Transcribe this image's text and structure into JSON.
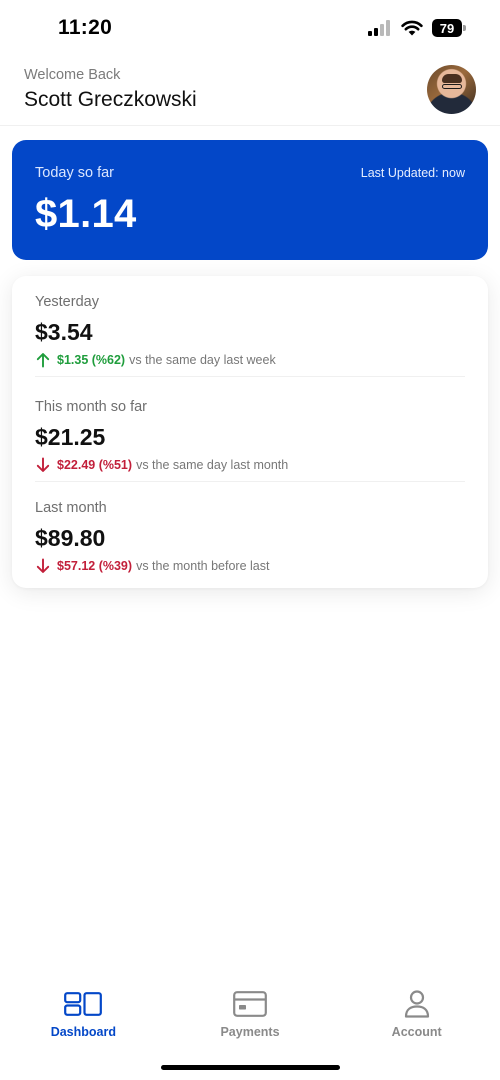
{
  "status_bar": {
    "time": "11:20",
    "battery": "79",
    "icons": [
      "cellular-signal-icon",
      "wifi-icon",
      "battery-icon"
    ]
  },
  "header": {
    "welcome": "Welcome Back",
    "user_name": "Scott Greczkowski"
  },
  "today": {
    "label": "Today so far",
    "last_updated": "Last Updated: now",
    "amount": "$1.14",
    "background_color": "#0347c8"
  },
  "stats": [
    {
      "title": "Yesterday",
      "amount": "$3.54",
      "direction": "up",
      "change": "$1.35 (%62)",
      "suffix": "vs the same day last week"
    },
    {
      "title": "This month so far",
      "amount": "$21.25",
      "direction": "down",
      "change": "$22.49 (%51)",
      "suffix": "vs the same day last month"
    },
    {
      "title": "Last month",
      "amount": "$89.80",
      "direction": "down",
      "change": "$57.12 (%39)",
      "suffix": "vs the month before last"
    }
  ],
  "colors": {
    "accent": "#0347c8",
    "positive": "#1f9d3c",
    "negative": "#c21f3a"
  },
  "nav": [
    {
      "label": "Dashboard",
      "icon": "dashboard-icon",
      "active": true
    },
    {
      "label": "Payments",
      "icon": "credit-card-icon",
      "active": false
    },
    {
      "label": "Account",
      "icon": "person-icon",
      "active": false
    }
  ]
}
